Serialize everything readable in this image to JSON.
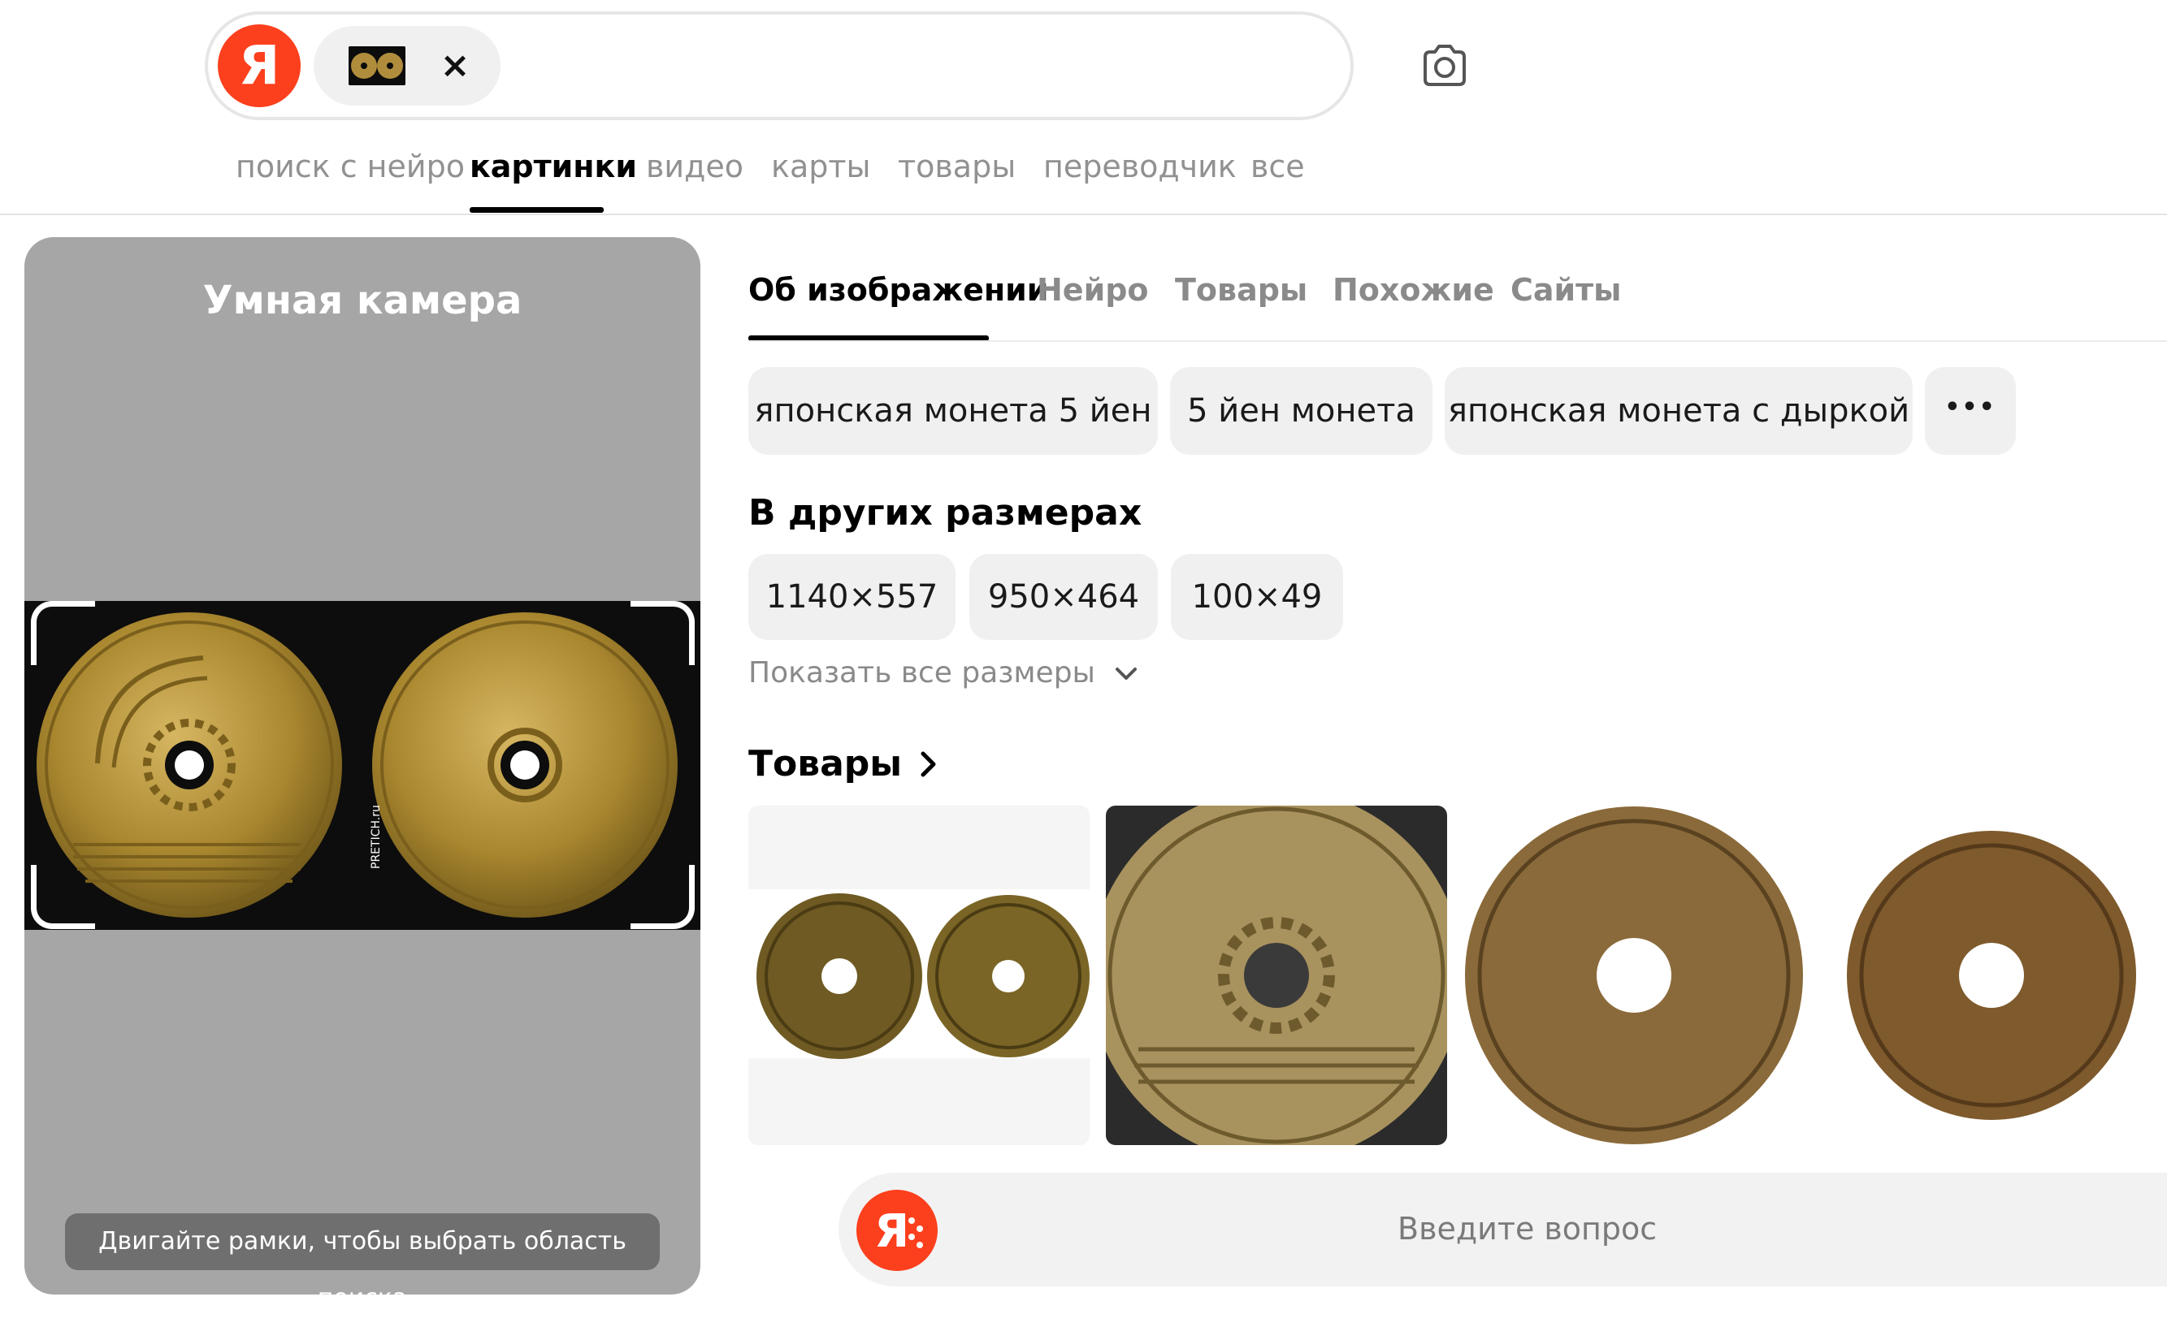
{
  "header": {
    "logo_letter": "Я",
    "clear_symbol": "×",
    "camera_icon": "camera-icon",
    "nav": [
      {
        "label": "поиск с нейро",
        "active": false
      },
      {
        "label": "картинки",
        "active": true
      },
      {
        "label": "видео",
        "active": false
      },
      {
        "label": "карты",
        "active": false
      },
      {
        "label": "товары",
        "active": false
      },
      {
        "label": "переводчик",
        "active": false
      },
      {
        "label": "все",
        "active": false
      }
    ]
  },
  "smart_camera": {
    "title": "Умная камера",
    "hint": "Двигайте рамки, чтобы выбрать область поиска",
    "watermark": "PRETICH.ru"
  },
  "tabs": [
    {
      "label": "Об изображении",
      "active": true
    },
    {
      "label": "Нейро",
      "active": false
    },
    {
      "label": "Товары",
      "active": false
    },
    {
      "label": "Похожие",
      "active": false
    },
    {
      "label": "Сайты",
      "active": false
    }
  ],
  "tags": [
    "японская монета 5 йен",
    "5 йен монета",
    "японская монета с дыркой"
  ],
  "more_symbol": "•••",
  "sizes": {
    "heading": "В других размерах",
    "items": [
      "1140×557",
      "950×464",
      "100×49"
    ],
    "show_all": "Показать все размеры"
  },
  "products": {
    "heading": "Товары",
    "items": [
      "product-coin-pair",
      "product-coin-closeup",
      "product-coin-worn",
      "product-coin-side"
    ]
  },
  "ask": {
    "placeholder": "Введите вопрос"
  },
  "colors": {
    "brand_red": "#fc3f1d",
    "panel_gray": "#a6a6a6",
    "chip_bg": "#f0f0f0",
    "coin_gold": "#b08d3c"
  }
}
